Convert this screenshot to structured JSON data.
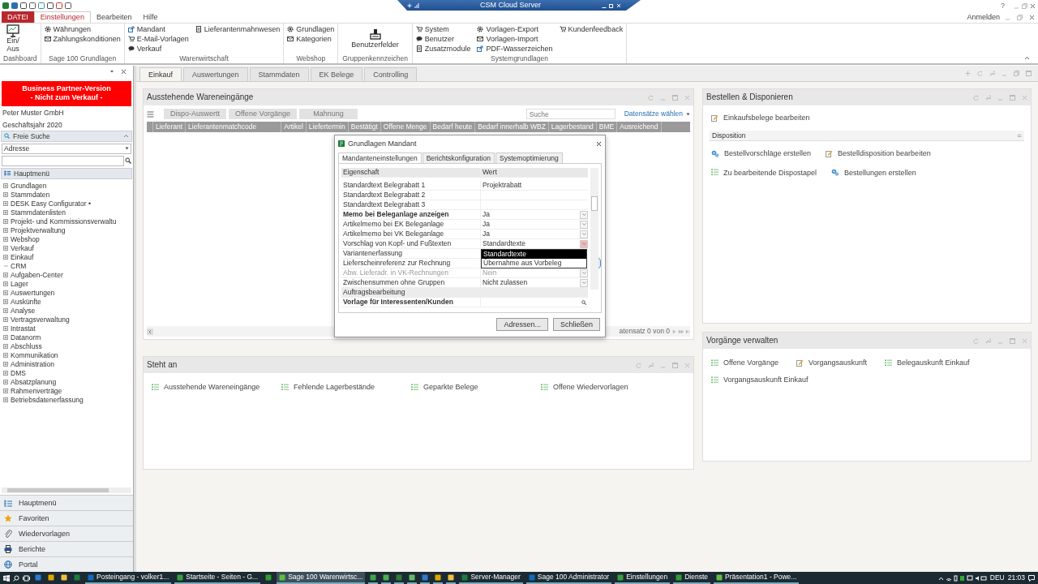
{
  "title_bar": {
    "remote_title": "CSM Cloud Server",
    "help": "?"
  },
  "ribbon": {
    "tabs": [
      {
        "label": "DATEI",
        "kind": "file",
        "selected": false
      },
      {
        "label": "Einstellungen",
        "kind": "tab",
        "selected": true
      },
      {
        "label": "Bearbeiten",
        "kind": "tab",
        "selected": false
      },
      {
        "label": "Hilfe",
        "kind": "tab",
        "selected": false
      }
    ],
    "account": "Anmelden",
    "groups": [
      {
        "label": "Dashboard",
        "columns": [
          [
            {
              "label": "Ein/\nAus",
              "kind": "large"
            }
          ]
        ]
      },
      {
        "label": "Sage 100 Grundlagen",
        "columns": [
          [
            {
              "label": "Währungen",
              "kind": "small"
            },
            {
              "label": "Zahlungskonditionen",
              "kind": "small"
            }
          ]
        ]
      },
      {
        "label": "Warenwirtschaft",
        "columns": [
          [
            {
              "label": "Mandant",
              "kind": "small"
            },
            {
              "label": "E-Mail-Vorlagen",
              "kind": "small"
            },
            {
              "label": "Verkauf",
              "kind": "small"
            }
          ],
          [
            {
              "label": "Lieferantenmahnwesen",
              "kind": "small"
            }
          ]
        ]
      },
      {
        "label": "Webshop",
        "columns": [
          [
            {
              "label": "Grundlagen",
              "kind": "small"
            },
            {
              "label": "Kategorien",
              "kind": "small"
            }
          ]
        ]
      },
      {
        "label": "Gruppenkennzeichen",
        "columns": [
          [
            {
              "label": "Benutzerfelder",
              "kind": "large"
            }
          ]
        ]
      },
      {
        "label": "Systemgrundlagen",
        "columns": [
          [
            {
              "label": "System",
              "kind": "small"
            },
            {
              "label": "Benutzer",
              "kind": "small"
            },
            {
              "label": "Zusatzmodule",
              "kind": "small"
            }
          ],
          [
            {
              "label": "Vorlagen-Export",
              "kind": "small"
            },
            {
              "label": "Vorlagen-Import",
              "kind": "small"
            },
            {
              "label": "PDF-Wasserzeichen",
              "kind": "small"
            }
          ],
          [
            {
              "label": "Kundenfeedback",
              "kind": "small"
            }
          ]
        ]
      }
    ]
  },
  "sidebar": {
    "banner": "Business Partner-Version\n- Nicht zum Verkauf -",
    "company": "Peter Muster GmbH",
    "fiscal_year": "Geschäftsjahr 2020",
    "search": {
      "title": "Freie Suche",
      "expanded": true,
      "scope": "Adresse"
    },
    "menu_title": "Hauptmenü",
    "tree": [
      {
        "label": "Grundlagen",
        "kind": "folder"
      },
      {
        "label": "Stammdaten",
        "kind": "folder"
      },
      {
        "label": "DESK Easy Configurator •",
        "kind": "folder"
      },
      {
        "label": "Stammdatenlisten",
        "kind": "folder"
      },
      {
        "label": "Projekt- und Kommissionsverwaltu",
        "kind": "folder"
      },
      {
        "label": "Projektverwaltung",
        "kind": "folder"
      },
      {
        "label": "Webshop",
        "kind": "folder"
      },
      {
        "label": "Verkauf",
        "kind": "folder"
      },
      {
        "label": "Einkauf",
        "kind": "folder"
      },
      {
        "label": "CRM",
        "kind": "leaf"
      },
      {
        "label": "Aufgaben-Center",
        "kind": "folder"
      },
      {
        "label": "Lager",
        "kind": "folder"
      },
      {
        "label": "Auswertungen",
        "kind": "folder"
      },
      {
        "label": "Auskünfte",
        "kind": "folder"
      },
      {
        "label": "Analyse",
        "kind": "folder"
      },
      {
        "label": "Vertragsverwaltung",
        "kind": "folder"
      },
      {
        "label": "Intrastat",
        "kind": "folder"
      },
      {
        "label": "Datanorm",
        "kind": "folder"
      },
      {
        "label": "Abschluss",
        "kind": "folder"
      },
      {
        "label": "Kommunikation",
        "kind": "folder"
      },
      {
        "label": "Administration",
        "kind": "folder"
      },
      {
        "label": "DMS",
        "kind": "folder"
      },
      {
        "label": "Absatzplanung",
        "kind": "folder"
      },
      {
        "label": "Rahmenverträge",
        "kind": "folder"
      },
      {
        "label": "Betriebsdatenerfassung",
        "kind": "folder"
      }
    ],
    "nav": [
      {
        "label": "Hauptmenü",
        "kind": "menu"
      },
      {
        "label": "Favoriten",
        "kind": "star"
      },
      {
        "label": "Wiedervorlagen",
        "kind": "clip"
      },
      {
        "label": "Berichte",
        "kind": "printer"
      },
      {
        "label": "Portal",
        "kind": "globe"
      }
    ]
  },
  "main": {
    "tabs": [
      {
        "label": "Einkauf",
        "selected": true
      },
      {
        "label": "Auswertungen",
        "selected": false
      },
      {
        "label": "Stammdaten",
        "selected": false
      },
      {
        "label": "EK Belege",
        "selected": false
      },
      {
        "label": "Controlling",
        "selected": false
      }
    ],
    "incoming": {
      "title": "Ausstehende Wareneingänge",
      "buttons": [
        {
          "label": "Dispo-Auswertt",
          "disabled": true
        },
        {
          "label": "Offene Vorgänge",
          "disabled": true
        },
        {
          "label": "Mahnung",
          "disabled": true
        }
      ],
      "search_placeholder": "Suche",
      "record_menu": "Datensätze wählen",
      "columns": [
        "Lieferant",
        "Lieferantenmatchcode",
        "Artikel",
        "Liefertermin",
        "Bestätigt",
        "Offene Menge",
        "Bedarf heute",
        "Bedarf innerhalb WBZ",
        "Lagerbestand",
        "BME",
        "Ausreichend"
      ],
      "record_count": "atensatz 0 von 0"
    },
    "pending": {
      "title": "Steht an",
      "links": [
        {
          "label": "Ausstehende Wareneingänge",
          "kind": "list"
        },
        {
          "label": "Fehlende Lagerbestände",
          "kind": "list"
        },
        {
          "label": "Geparkte Belege",
          "kind": "list"
        },
        {
          "label": "Offene Wiedervorlagen",
          "kind": "list"
        }
      ]
    },
    "ordering": {
      "title": "Bestellen & Disponieren",
      "links": [
        {
          "label": "Einkaufsbelege bearbeiten",
          "kind": "edit"
        }
      ],
      "section": {
        "title": "Disposition",
        "expanded": true,
        "links": [
          {
            "label": "Bestellvorschläge erstellen",
            "kind": "gears"
          },
          {
            "label": "Bestelldisposition bearbeiten",
            "kind": "edit"
          },
          {
            "label": "Zu bearbeitende Dispostapel",
            "kind": "list"
          },
          {
            "label": "Bestellungen erstellen",
            "kind": "gears"
          }
        ]
      }
    },
    "processes": {
      "title": "Vorgänge verwalten",
      "links": [
        {
          "label": "Offene Vorgänge",
          "kind": "list"
        },
        {
          "label": "Vorgangsauskunft",
          "kind": "edit"
        },
        {
          "label": "Belegauskunft Einkauf",
          "kind": "list"
        },
        {
          "label": "Vorgangsauskunft Einkauf",
          "kind": "list"
        }
      ]
    }
  },
  "dialog": {
    "title": "Grundlagen Mandant",
    "tabs": [
      {
        "label": "Mandanteneinstellungen",
        "selected": true
      },
      {
        "label": "Berichtskonfiguration",
        "selected": false
      },
      {
        "label": "Systemoptimierung",
        "selected": false
      }
    ],
    "columns": [
      "Eigenschaft",
      "Wert"
    ],
    "rows": [
      {
        "label": "Standardtext Belegrabatt 1",
        "value": "Projektrabatt",
        "kind": "text",
        "bold": false,
        "disabled": false
      },
      {
        "label": "Standardtext Belegrabatt 2",
        "kind": "text",
        "bold": false,
        "disabled": false
      },
      {
        "label": "Standardtext Belegrabatt 3",
        "kind": "text",
        "bold": false,
        "disabled": false
      },
      {
        "label": "Memo bei Beleganlage anzeigen",
        "value": "Ja",
        "kind": "combo",
        "open": false,
        "bold": true,
        "disabled": false
      },
      {
        "label": "Artikelmemo bei EK Beleganlage",
        "value": "Ja",
        "kind": "combo",
        "open": false,
        "bold": false,
        "disabled": false
      },
      {
        "label": "Artikelmemo bei VK Beleganlage",
        "value": "Ja",
        "kind": "combo",
        "open": false,
        "bold": false,
        "disabled": false
      },
      {
        "label": "Vorschlag von Kopf- und Fußtexten",
        "value": "Standardtexte",
        "kind": "combo",
        "open": true,
        "bold": false,
        "disabled": false,
        "options": [
          {
            "label": "Standardtexte",
            "selected": true
          },
          {
            "label": "Übernahme aus Vorbeleg",
            "selected": false
          }
        ]
      },
      {
        "label": "Variantenerfassung",
        "kind": "text",
        "bold": false,
        "disabled": false
      },
      {
        "label": "Lieferscheinreferenz zur Rechnung",
        "kind": "text",
        "bold": false,
        "disabled": false
      },
      {
        "label": "Abw. Lieferadr. in VK-Rechnungen",
        "value": "Nein",
        "kind": "combo",
        "open": false,
        "bold": false,
        "disabled": true
      },
      {
        "label": "Zwischensummen ohne Gruppen",
        "value": "Nicht zulassen",
        "kind": "combo",
        "open": false,
        "bold": false,
        "disabled": false
      },
      {
        "label": "Auftragsbearbeitung",
        "kind": "section",
        "bold": false,
        "disabled": false
      },
      {
        "label": "Vorlage für Interessenten/Kunden",
        "kind": "search",
        "bold": true,
        "disabled": false
      }
    ],
    "buttons": [
      "Adressen...",
      "Schließen"
    ]
  },
  "taskbar": {
    "items": [
      {
        "kind": "start"
      },
      {
        "kind": "search"
      },
      {
        "kind": "taskview"
      },
      {
        "kind": "pinned",
        "running": false
      },
      {
        "kind": "pinned",
        "running": false
      },
      {
        "kind": "pinned",
        "running": false
      },
      {
        "kind": "pinned",
        "running": false
      },
      {
        "kind": "app",
        "label": "Posteingang - volker1...",
        "selected": false
      },
      {
        "kind": "app",
        "label": "Startseite - Seiten - G...",
        "selected": false
      },
      {
        "kind": "pinned",
        "running": false
      },
      {
        "kind": "app",
        "label": "Sage 100 Warenwirtsc...",
        "selected": true
      },
      {
        "kind": "pinned",
        "running": true
      },
      {
        "kind": "pinned",
        "running": true
      },
      {
        "kind": "pinned",
        "running": true
      },
      {
        "kind": "pinned",
        "running": true
      },
      {
        "kind": "pinned",
        "running": true
      },
      {
        "kind": "pinned",
        "running": true
      },
      {
        "kind": "pinned",
        "running": true
      },
      {
        "kind": "app",
        "label": "Server-Manager",
        "selected": false
      },
      {
        "kind": "app",
        "label": "Sage 100 Administrator",
        "selected": false
      },
      {
        "kind": "app",
        "label": "Einstellungen",
        "selected": false
      },
      {
        "kind": "app",
        "label": "Dienste",
        "selected": false
      },
      {
        "kind": "app",
        "label": "Präsentation1 - Powe...",
        "selected": false
      }
    ],
    "language": "DEU",
    "time": "21:03"
  }
}
